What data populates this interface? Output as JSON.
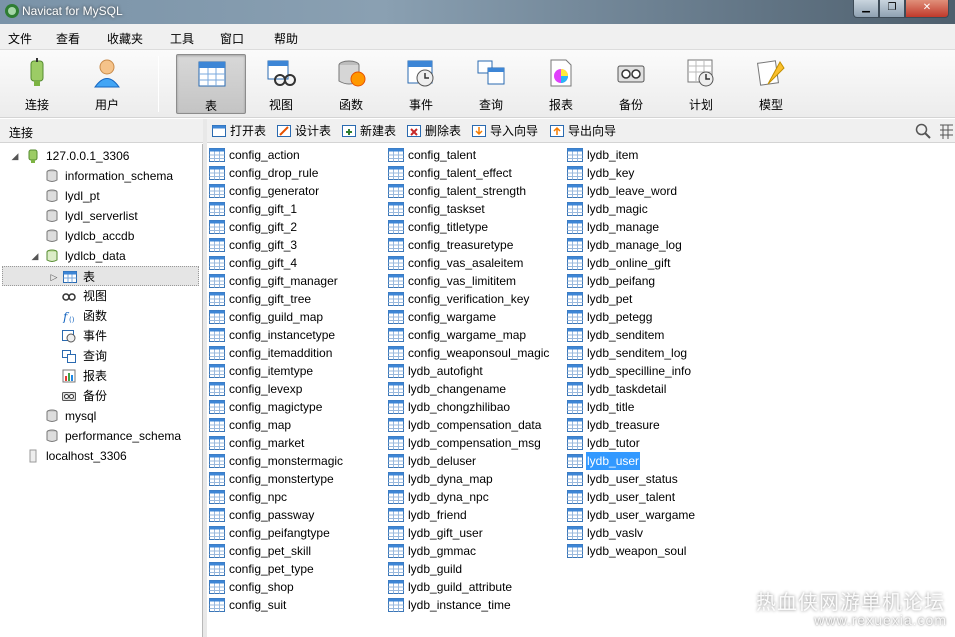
{
  "window": {
    "title": "Navicat for MySQL",
    "minimize": "▁",
    "restore": "❐",
    "close": "✕"
  },
  "menu": [
    "文件",
    "查看",
    "收藏夹",
    "工具",
    "窗口",
    "帮助"
  ],
  "toolbar": [
    {
      "label": "连接",
      "icon": "connection-icon"
    },
    {
      "label": "用户",
      "icon": "user-icon"
    },
    {
      "label": "表",
      "icon": "table-icon",
      "active": true
    },
    {
      "label": "视图",
      "icon": "view-icon"
    },
    {
      "label": "函数",
      "icon": "function-icon"
    },
    {
      "label": "事件",
      "icon": "event-icon"
    },
    {
      "label": "查询",
      "icon": "query-icon"
    },
    {
      "label": "报表",
      "icon": "report-icon"
    },
    {
      "label": "备份",
      "icon": "backup-icon"
    },
    {
      "label": "计划",
      "icon": "schedule-icon"
    },
    {
      "label": "模型",
      "icon": "model-icon"
    }
  ],
  "left_panel": {
    "header": "连接"
  },
  "tree": {
    "connection": "127.0.0.1_3306",
    "databases": [
      "information_schema",
      "lydl_pt",
      "lydl_serverlist",
      "lydlcb_accdb",
      "lydlcb_data"
    ],
    "objects": [
      "表",
      "视图",
      "函数",
      "事件",
      "查询",
      "报表",
      "备份"
    ],
    "more_databases": [
      "mysql",
      "performance_schema"
    ],
    "other_connection": "localhost_3306"
  },
  "object_toolbar": [
    "打开表",
    "设计表",
    "新建表",
    "删除表",
    "导入向导",
    "导出向导"
  ],
  "tables": {
    "col1": [
      "config_action",
      "config_drop_rule",
      "config_generator",
      "config_gift_1",
      "config_gift_2",
      "config_gift_3",
      "config_gift_4",
      "config_gift_manager",
      "config_gift_tree",
      "config_guild_map",
      "config_instancetype",
      "config_itemaddition",
      "config_itemtype",
      "config_levexp",
      "config_magictype",
      "config_map",
      "config_market",
      "config_monstermagic",
      "config_monstertype",
      "config_npc",
      "config_passway",
      "config_peifangtype",
      "config_pet_skill",
      "config_pet_type",
      "config_shop",
      "config_suit"
    ],
    "col2": [
      "config_talent",
      "config_talent_effect",
      "config_talent_strength",
      "config_taskset",
      "config_titletype",
      "config_treasuretype",
      "config_vas_asaleitem",
      "config_vas_limititem",
      "config_verification_key",
      "config_wargame",
      "config_wargame_map",
      "config_weaponsoul_magic",
      "lydb_autofight",
      "lydb_changename",
      "lydb_chongzhilibao",
      "lydb_compensation_data",
      "lydb_compensation_msg",
      "lydb_deluser",
      "lydb_dyna_map",
      "lydb_dyna_npc",
      "lydb_friend",
      "lydb_gift_user",
      "lydb_gmmac",
      "lydb_guild",
      "lydb_guild_attribute",
      "lydb_instance_time"
    ],
    "col3": [
      "lydb_item",
      "lydb_key",
      "lydb_leave_word",
      "lydb_magic",
      "lydb_manage",
      "lydb_manage_log",
      "lydb_online_gift",
      "lydb_peifang",
      "lydb_pet",
      "lydb_petegg",
      "lydb_senditem",
      "lydb_senditem_log",
      "lydb_specilline_info",
      "lydb_taskdetail",
      "lydb_title",
      "lydb_treasure",
      "lydb_tutor",
      "lydb_user",
      "lydb_user_status",
      "lydb_user_talent",
      "lydb_user_wargame",
      "lydb_vaslv",
      "lydb_weapon_soul"
    ],
    "selected": "lydb_user"
  },
  "watermark": {
    "line1": "热血侠网游单机论坛",
    "line2": "www.rexuexia.com"
  }
}
